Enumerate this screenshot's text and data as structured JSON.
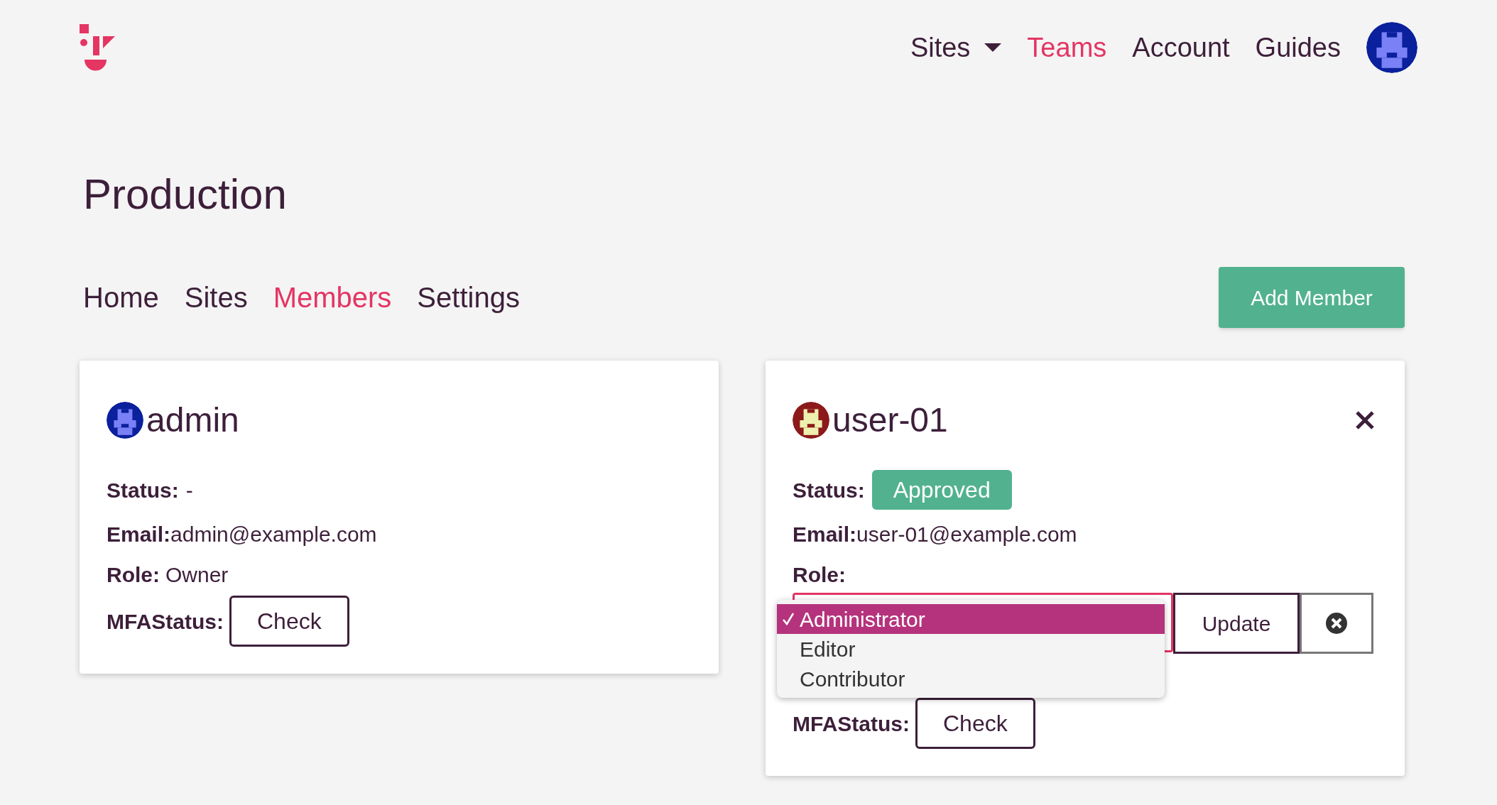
{
  "header": {
    "avatar": {
      "color": "#0a209c"
    },
    "nav": [
      {
        "label": "Sites",
        "selected": false,
        "dropdown": true
      },
      {
        "label": "Teams",
        "selected": true,
        "dropdown": false
      },
      {
        "label": "Account",
        "selected": false,
        "dropdown": false
      },
      {
        "label": "Guides",
        "selected": false,
        "dropdown": false
      }
    ]
  },
  "page_title": "Production",
  "tabs": [
    {
      "label": "Home",
      "selected": false
    },
    {
      "label": "Sites",
      "selected": false
    },
    {
      "label": "Members",
      "selected": true
    },
    {
      "label": "Settings",
      "selected": false
    }
  ],
  "add_button": "Add Member",
  "members": [
    {
      "name": "admin",
      "avatar": {
        "color": "#0a209c"
      },
      "closable": false,
      "status": {
        "label": "Status:",
        "value": "-",
        "kind": "text"
      },
      "email": {
        "label": "Email:",
        "value": "admin@example.com"
      },
      "role": {
        "label": "Role:",
        "kind": "text",
        "value": "Owner"
      },
      "mfa": {
        "label": "MFAStatus:",
        "button": "Check"
      }
    },
    {
      "name": "user-01",
      "avatar": {
        "color": "#8c1a1a"
      },
      "closable": true,
      "status": {
        "label": "Status:",
        "value": "Approved",
        "kind": "badge"
      },
      "email": {
        "label": "Email:",
        "value": "user-01@example.com"
      },
      "role": {
        "label": "Role:",
        "kind": "select",
        "update_button": "Update",
        "options": [
          {
            "label": "Administrator",
            "selected": true
          },
          {
            "label": "Editor",
            "selected": false
          },
          {
            "label": "Contributor",
            "selected": false
          }
        ]
      },
      "mfa": {
        "label": "MFAStatus:",
        "button": "Check"
      }
    }
  ]
}
